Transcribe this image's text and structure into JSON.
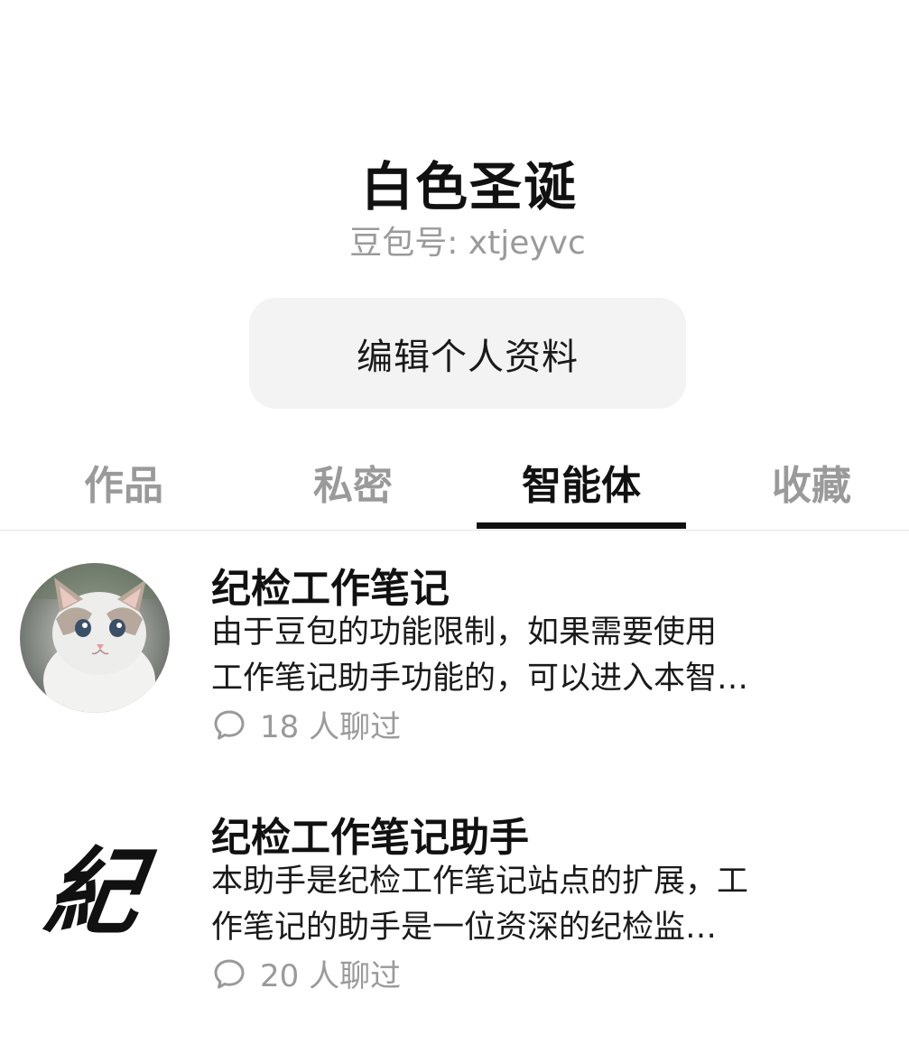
{
  "profile": {
    "name": "白色圣诞",
    "id_text": "豆包号: xtjeyvc",
    "edit_button": "编辑个人资料"
  },
  "tabs": [
    {
      "label": "作品",
      "active": false
    },
    {
      "label": "私密",
      "active": false
    },
    {
      "label": "智能体",
      "active": true
    },
    {
      "label": "收藏",
      "active": false
    }
  ],
  "agents": [
    {
      "title": "纪检工作笔记",
      "desc_line1": "由于豆包的功能限制，如果需要使用",
      "desc_line2": "工作笔记助手功能的，可以进入本智…",
      "chats": "18 人聊过",
      "avatar": "cat-photo"
    },
    {
      "title": "纪检工作笔记助手",
      "desc_line1": "本助手是纪检工作笔记站点的扩展，工",
      "desc_line2": "作笔记的助手是一位资深的纪检监…",
      "chats": "20 人聊过",
      "avatar": "calligraphy-logo",
      "avatar_text": "紀"
    }
  ],
  "colors": {
    "text_primary": "#111111",
    "text_secondary": "#9a9a9a",
    "button_bg": "#f3f3f3",
    "tab_indicator": "#111111"
  },
  "icons": {
    "chat": "chat-bubble-icon"
  }
}
